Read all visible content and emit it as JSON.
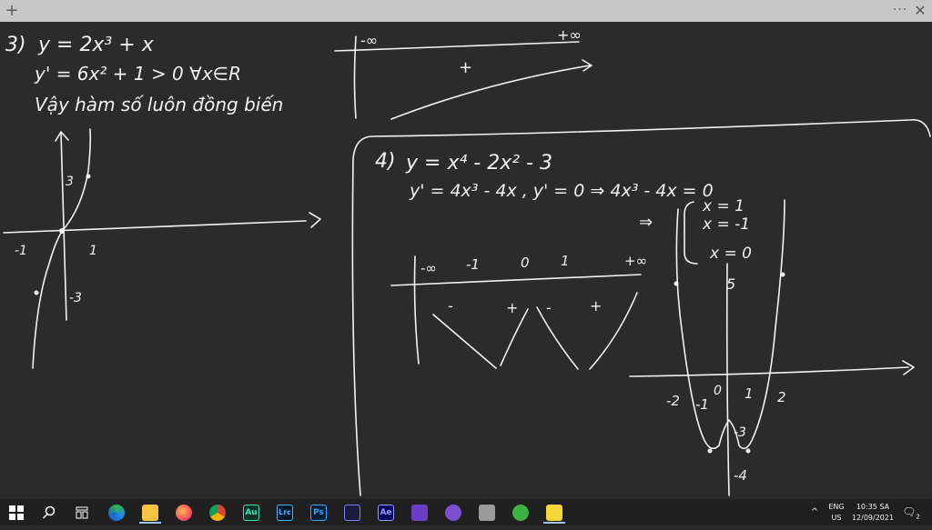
{
  "window": {
    "new_tab_symbol": "+",
    "more_symbol": "···",
    "close_symbol": "✕"
  },
  "problem3": {
    "number": "3)",
    "function": "y = 2x³ + x",
    "derivative": "y' = 6x² + 1 > 0  ∀x∈R",
    "conclusion": "Vậy hàm số luôn đồng biến",
    "table_neg_inf": "-∞",
    "table_pos_inf": "+∞",
    "table_sign": "+",
    "graph_labels": {
      "y_pos3": "3",
      "y_neg3": "-3",
      "x_neg1": "-1",
      "x_pos1": "1"
    }
  },
  "problem4": {
    "number": "4)",
    "function": "y = x⁴ - 2x² - 3",
    "derivative": "y' = 4x³ - 4x ,  y' = 0 ⇒ 4x³ - 4x = 0",
    "implies": "⇒",
    "roots": [
      "x = 1",
      "x = -1",
      "x = 0"
    ],
    "table_header": [
      "-∞",
      "-1",
      "0",
      "1",
      "+∞"
    ],
    "table_signs": [
      "-",
      "+",
      "-",
      "+"
    ],
    "graph_labels": {
      "y_max": "-3",
      "y_min": "-4",
      "y_top": "5",
      "x_neg2": "-2",
      "x_neg1": "-1",
      "x_zero": "0",
      "x_pos1": "1",
      "x_pos2": "2"
    }
  },
  "taskbar": {
    "apps": [
      {
        "name": "windows-start",
        "label": ""
      },
      {
        "name": "search",
        "label": ""
      },
      {
        "name": "task-view",
        "label": ""
      },
      {
        "name": "edge",
        "label": ""
      },
      {
        "name": "file-explorer",
        "label": ""
      },
      {
        "name": "firefox",
        "label": ""
      },
      {
        "name": "chrome",
        "label": ""
      },
      {
        "name": "audition",
        "label": "Au"
      },
      {
        "name": "lightroom-classic",
        "label": "Lrc"
      },
      {
        "name": "photoshop",
        "label": "Ps"
      },
      {
        "name": "app-dark",
        "label": ""
      },
      {
        "name": "after-effects",
        "label": "Ae"
      },
      {
        "name": "app-purple",
        "label": ""
      },
      {
        "name": "github",
        "label": ""
      },
      {
        "name": "app-gray",
        "label": ""
      },
      {
        "name": "app-green",
        "label": ""
      },
      {
        "name": "sticky-notes",
        "label": ""
      }
    ],
    "tray": {
      "chevron": "^",
      "lang_top": "ENG",
      "lang_bottom": "US",
      "time": "10:35 SA",
      "date": "12/09/2021",
      "notification_count": "2"
    }
  }
}
